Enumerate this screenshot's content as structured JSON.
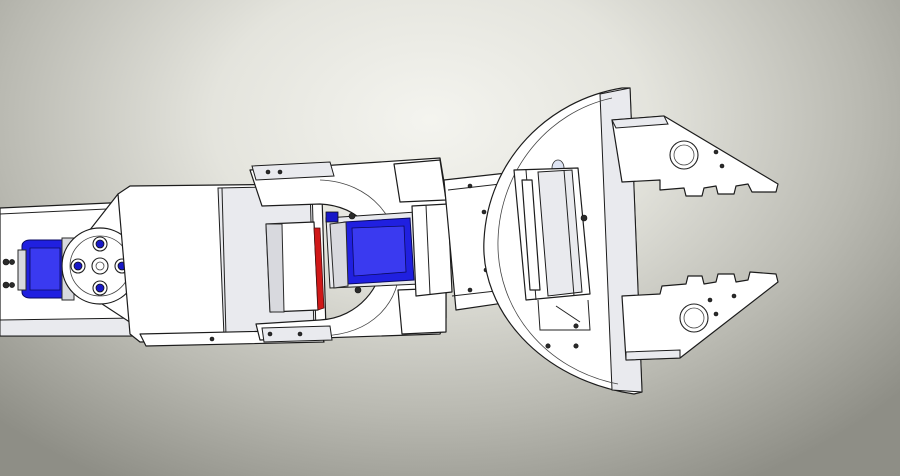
{
  "viewport": {
    "background_top": "#f4f4ef",
    "background_bottom": "#8e8e86"
  },
  "colors": {
    "part_fill": "#ffffff",
    "edge": "#1c1c1c",
    "servo_blue": "#2020e0",
    "accent_red": "#d01818"
  },
  "parts": [
    "base-arm-bracket",
    "wrist-servo-horn",
    "elbow-servo-block",
    "u-bracket-connector",
    "small-blue-servo",
    "wrist-bracket-plate",
    "gripper-servo",
    "semicircular-gripper-base",
    "upper-gripper-jaw",
    "lower-gripper-jaw"
  ]
}
